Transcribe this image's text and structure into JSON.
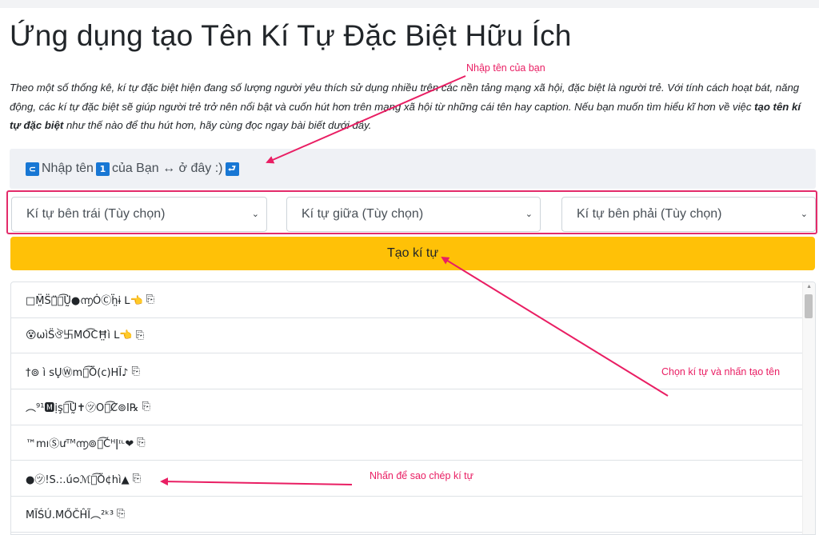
{
  "page": {
    "title": "Ứng dụng tạo Tên Kí Tự Đặc Biệt Hữu Ích",
    "intro_part1": "Theo một số thống kê, kí tự đặc biệt hiện đang số lượng người yêu thích sử dụng nhiều trên các nền tảng mạng xã hội, đặc biệt là người trẻ. Với tính cách hoạt bát, năng động, các kí tự đặc biệt sẽ giúp người trẻ trở nên nổi bật và cuốn hút hơn trên mạng xã hội từ những cái tên hay caption. Nếu bạn muốn tìm hiểu kĩ hơn về việc ",
    "intro_bold": "tạo tên kí tự đặc biệt",
    "intro_part2": " như thế nào để thu hút hơn, hãy cùng đọc ngay bài biết dưới đây."
  },
  "input": {
    "badge_left": "⊂",
    "word1": "Nhập tên",
    "badge_mid": "1",
    "word2": " của Bạn ↔ ở đây :)",
    "badge_right": "⮐"
  },
  "selects": {
    "left": "Kí tự bên trái (Tùy chọn)",
    "middle": "Kí tự giữa (Tùy chọn)",
    "right": "Kí tự bên phải (Tùy chọn)",
    "chevron": "⌄"
  },
  "generate_label": "Tạo kí tự",
  "results": [
    "□M̤̈S̈ঃ̈ঠ͡Ṵ̈●൬ȮⒸḧ̤ɨ ᒪ👈",
    "😵ωìS̈ঔ卐MO͡CĦ̤ì ᒪ👈",
    "†⊚ ì sU̟Ⓦmঠ͡Ö(c)HĨ♪",
    "︵⁹¹🅼ịşঠ͡Ṵ̈✝㋡Oঠ͡Ȼ⊚I℞",
    "™mıⓈưᵀᴹ൬⊚ঠ͡Ćᴴǀᶦᶫ❤",
    "●㋡!S.:.úᴑℳঠ͡Ö¢hì▲",
    "MĨŚÚ.MŐČĤĨ︵²ᵏ³"
  ],
  "copy_icon": "⎘",
  "annotations": {
    "enter_name": "Nhập tên của bạn",
    "choose_chars": "Chọn kí tự và nhấn tạo tên",
    "click_copy": "Nhấn để sao chép kí tự"
  },
  "colors": {
    "accent_yellow": "#ffc107",
    "annotation_pink": "#e91e63",
    "badge_blue": "#1877d4"
  }
}
